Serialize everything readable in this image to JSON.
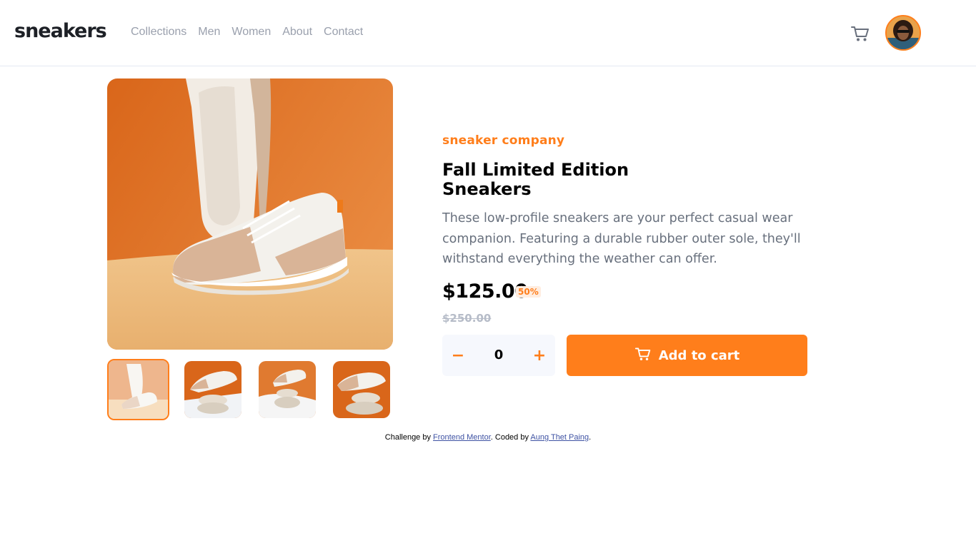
{
  "header": {
    "logo": "sneakers",
    "nav": [
      "Collections",
      "Men",
      "Women",
      "About",
      "Contact"
    ],
    "cart_icon": "cart-icon",
    "avatar_icon": "user-avatar"
  },
  "gallery": {
    "main_image": "sneaker-product-image-1",
    "thumbnails": [
      "sneaker-thumb-1",
      "sneaker-thumb-2",
      "sneaker-thumb-3",
      "sneaker-thumb-4"
    ],
    "active_thumbnail": 1
  },
  "product": {
    "company": "sneaker company",
    "title_line1": "Fall Limited Edition",
    "title_line2": "Sneakers",
    "description": "These low-profile sneakers are your perfect casual wear companion. Featuring a durable rubber outer sole, they'll withstand everything the weather can offer.",
    "price": "$125.00",
    "discount": "50%",
    "original_price": "$250.00",
    "quantity": "0",
    "minus": "−",
    "plus": "+",
    "add_to_cart": "Add to cart"
  },
  "footer": {
    "prefix": "Challenge by ",
    "link1": "Frontend Mentor",
    "middle": ". Coded by ",
    "link2": "Aung Thet Paing",
    "suffix": "."
  },
  "colors": {
    "accent": "#ff7e1b",
    "accent_pale": "#ffede0",
    "text_dark": "#1d2026",
    "text_muted": "#68707d",
    "strike": "#b6bcc8"
  }
}
